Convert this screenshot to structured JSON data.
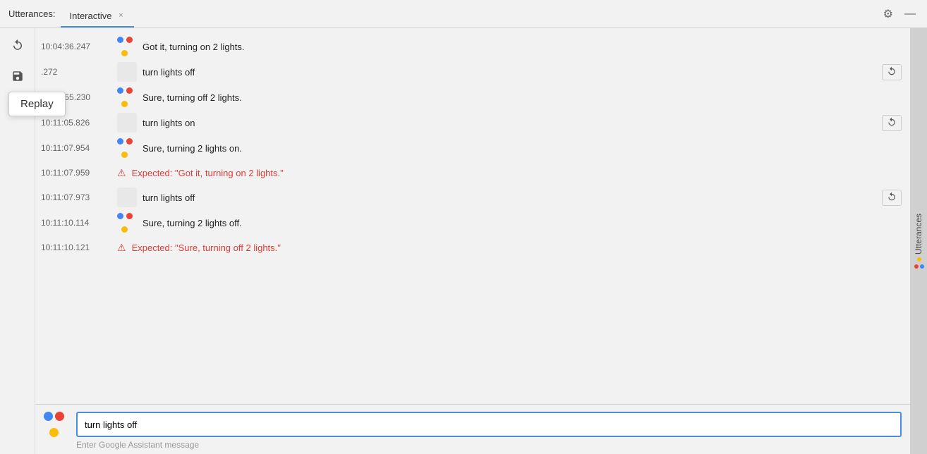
{
  "titlebar": {
    "utterances_label": "Utterances:",
    "tab_label": "Interactive",
    "tab_close": "×",
    "gear_icon": "⚙",
    "minimize_icon": "—"
  },
  "sidebar_controls": {
    "replay_icon": "↺",
    "save_icon": "⊟",
    "undo_icon": "↩"
  },
  "replay_tooltip": {
    "label": "Replay"
  },
  "messages": [
    {
      "id": 1,
      "timestamp": "10:04:36.247",
      "type": "assistant",
      "text": "Got it, turning on 2 lights."
    },
    {
      "id": 2,
      "timestamp": ".272",
      "type": "user_input",
      "text": "turn lights off",
      "has_replay": true
    },
    {
      "id": 3,
      "timestamp": "10:06:55.230",
      "type": "assistant",
      "text": "Sure, turning off 2 lights."
    },
    {
      "id": 4,
      "timestamp": "10:11:05.826",
      "type": "user_input",
      "text": "turn lights on",
      "has_replay": true
    },
    {
      "id": 5,
      "timestamp": "10:11:07.954",
      "type": "assistant",
      "text": "Sure, turning 2 lights on."
    },
    {
      "id": 6,
      "timestamp": "10:11:07.959",
      "type": "error",
      "text": "Expected: \"Got it, turning on 2 lights.\""
    },
    {
      "id": 7,
      "timestamp": "10:11:07.973",
      "type": "user_input",
      "text": "turn lights off",
      "has_replay": true
    },
    {
      "id": 8,
      "timestamp": "10:11:10.114",
      "type": "assistant",
      "text": "Sure, turning 2 lights off."
    },
    {
      "id": 9,
      "timestamp": "10:11:10.121",
      "type": "error",
      "text": "Expected: \"Sure, turning off 2 lights.\""
    }
  ],
  "input": {
    "value": "turn lights off",
    "placeholder": "Enter Google Assistant message"
  },
  "right_sidebar": {
    "label": "Utterances"
  }
}
